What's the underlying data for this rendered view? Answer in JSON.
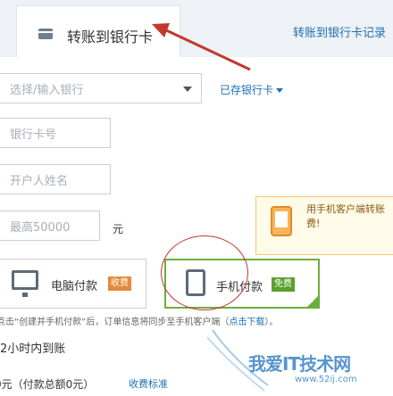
{
  "header": {
    "active_tab": "转账到银行卡",
    "record_link": "转账到银行卡记录",
    "tab_icon": "card-icon"
  },
  "form": {
    "bank_placeholder": "选择/输入银行",
    "saved_cards": "已存银行卡",
    "card_number_placeholder": "银行卡号",
    "holder_name_placeholder": "开户人姓名",
    "amount_placeholder": "最高50000",
    "amount_unit": "元"
  },
  "tip": {
    "text": "用手机客户端转账 费!",
    "icon": "phone-icon"
  },
  "payment": {
    "pc_label": "电脑付款",
    "pc_badge": "收费",
    "mobile_label": "手机付款",
    "mobile_badge": "免费"
  },
  "note": {
    "text": "点击“创建并手机付款”后，订单信息将同步至手机客户端（",
    "download": "点击下载",
    "tail": "）。"
  },
  "arrival": "2小时内到账",
  "fee": {
    "text": "0元（付款总额0元）",
    "standard_link": "收费标准"
  },
  "watermark": {
    "title": "我爱IT技术网",
    "url": "www.52ij.com"
  },
  "colors": {
    "link": "#1b6fb5",
    "active_option_border": "#6cae3b",
    "fee_badge": "#e58a3a",
    "free_badge": "#5aa02c",
    "annotation": "#c0392b"
  }
}
